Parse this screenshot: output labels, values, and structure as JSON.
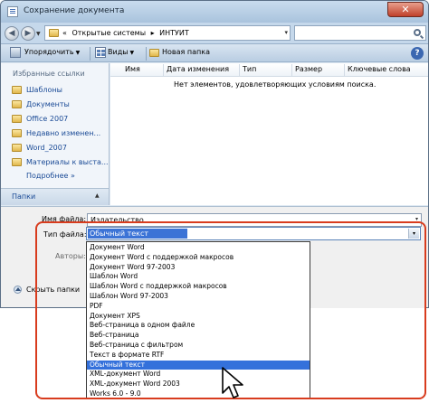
{
  "window": {
    "title": "Сохранение документа",
    "close_label": "✕"
  },
  "address_bar": {
    "crumbs": [
      "«",
      "Открытые системы",
      "▸",
      "ИНТУИТ"
    ],
    "back_label": "◀",
    "forward_label": "▶",
    "nav_dropdown_label": "▼",
    "refresh_label": "▾",
    "search_placeholder": ""
  },
  "toolbar": {
    "organize_label": "Упорядочить",
    "views_label": "Виды",
    "new_folder_label": "Новая папка",
    "help_label": "?",
    "caret_label": "▼"
  },
  "nav_pane": {
    "favorites_header": "Избранные ссылки",
    "items": [
      "Шаблоны",
      "Документы",
      "Office 2007",
      "Недавно изменен...",
      "Word_2007",
      "Материалы к выста..."
    ],
    "more_label": "Подробнее »",
    "folders_label": "Папки",
    "folders_caret": "▲"
  },
  "file_list": {
    "columns": [
      "Имя",
      "Дата изменения",
      "Тип",
      "Размер",
      "Ключевые слова"
    ],
    "empty_message": "Нет элементов, удовлетворяющих условиям поиска."
  },
  "form": {
    "filename_label": "Имя файла:",
    "filename_value": "Издательство",
    "filetype_label": "Тип файла:",
    "filetype_value": "Обычный текст",
    "authors_label": "Авторы:",
    "hide_folders_label": "Скрыть папки",
    "drop_arrow": "▾"
  },
  "filetype_options": [
    "Документ Word",
    "Документ Word с поддержкой макросов",
    "Документ Word 97-2003",
    "Шаблон Word",
    "Шаблон Word с поддержкой макросов",
    "Шаблон Word 97-2003",
    "PDF",
    "Документ XPS",
    "Веб-страница в одном файле",
    "Веб-страница",
    "Веб-страница с фильтром",
    "Текст в формате RTF",
    "Обычный текст",
    "XML-документ Word",
    "XML-документ Word 2003",
    "Works 6.0 - 9.0"
  ],
  "filetype_selected_index": 12,
  "colors": {
    "accent": "#3471db",
    "highlight_frame": "#d83c1e"
  }
}
